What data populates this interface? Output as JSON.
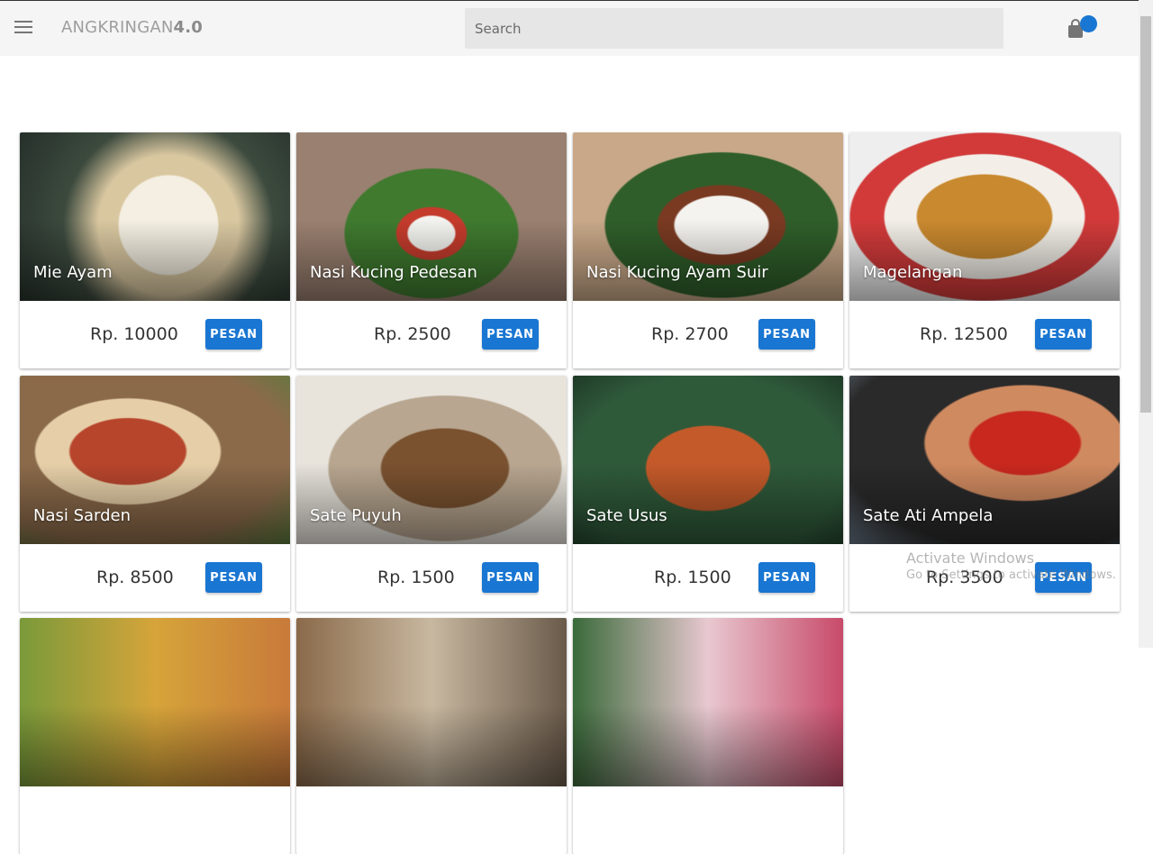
{
  "header": {
    "brand_light": "ANGKRINGAN",
    "brand_bold": "4.0",
    "search_placeholder": "Search",
    "menu_icon": "menu-icon",
    "cart_icon": "shopping-bag-icon",
    "accent_color": "#1976d2"
  },
  "products": [
    {
      "name": "Mie Ayam",
      "price": "Rp. 10000",
      "button": "PESAN"
    },
    {
      "name": "Nasi Kucing Pedesan",
      "price": "Rp. 2500",
      "button": "PESAN"
    },
    {
      "name": "Nasi Kucing Ayam Suir",
      "price": "Rp. 2700",
      "button": "PESAN"
    },
    {
      "name": "Magelangan",
      "price": "Rp. 12500",
      "button": "PESAN"
    },
    {
      "name": "Nasi Sarden",
      "price": "Rp. 8500",
      "button": "PESAN"
    },
    {
      "name": "Sate Puyuh",
      "price": "Rp. 1500",
      "button": "PESAN"
    },
    {
      "name": "Sate Usus",
      "price": "Rp. 1500",
      "button": "PESAN"
    },
    {
      "name": "Sate Ati Ampela",
      "price": "Rp. 3500",
      "button": "PESAN"
    }
  ],
  "watermark": {
    "title": "Activate Windows",
    "subtitle": "Go to Settings to activate Windows."
  }
}
